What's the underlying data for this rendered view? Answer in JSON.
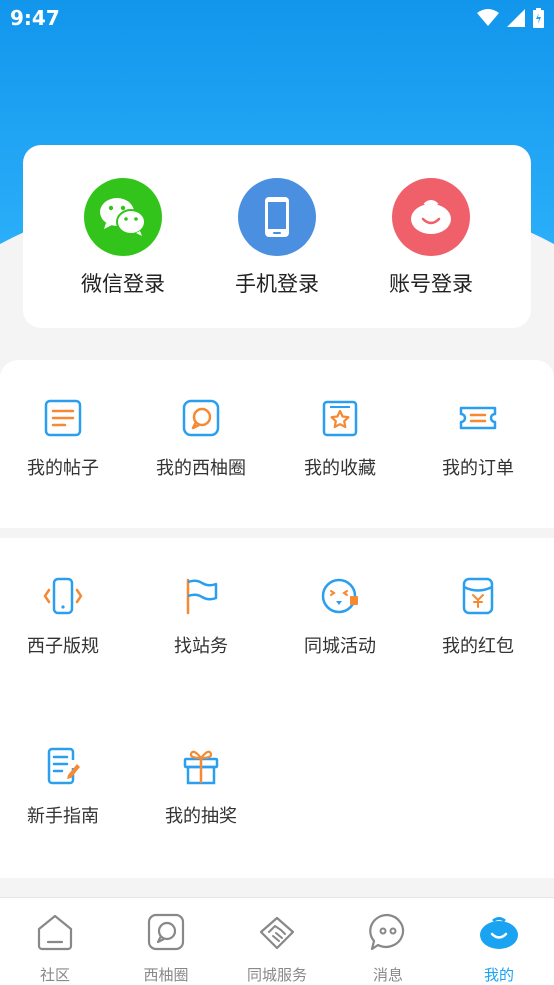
{
  "status_bar": {
    "time": "9:47"
  },
  "login": {
    "options": [
      {
        "label": "微信登录",
        "icon": "wechat-icon",
        "color": "#33c41b"
      },
      {
        "label": "手机登录",
        "icon": "phone-icon",
        "color": "#4a8fe0"
      },
      {
        "label": "账号登录",
        "icon": "account-icon",
        "color": "#f0606a"
      }
    ]
  },
  "menu_section_1": {
    "items": [
      {
        "label": "我的帖子",
        "icon": "posts-icon"
      },
      {
        "label": "我的西柚圈",
        "icon": "circle-chat-icon"
      },
      {
        "label": "我的收藏",
        "icon": "favorites-star-icon"
      },
      {
        "label": "我的订单",
        "icon": "order-ticket-icon"
      }
    ]
  },
  "menu_section_2": {
    "items": [
      {
        "label": "西子版规",
        "icon": "rules-phone-icon"
      },
      {
        "label": "找站务",
        "icon": "flag-icon"
      },
      {
        "label": "同城活动",
        "icon": "activity-face-icon"
      },
      {
        "label": "我的红包",
        "icon": "red-envelope-icon"
      },
      {
        "label": "新手指南",
        "icon": "guide-doc-icon"
      },
      {
        "label": "我的抽奖",
        "icon": "gift-icon"
      }
    ]
  },
  "tabbar": {
    "tabs": [
      {
        "label": "社区",
        "icon": "home-icon"
      },
      {
        "label": "西柚圈",
        "icon": "chat-square-icon"
      },
      {
        "label": "同城服务",
        "icon": "handshake-icon"
      },
      {
        "label": "消息",
        "icon": "message-icon"
      },
      {
        "label": "我的",
        "icon": "profile-icon",
        "active": true
      }
    ]
  },
  "colors": {
    "accent": "#1aa3f0",
    "icon_blue": "#2a9ff0",
    "icon_orange": "#f58a33"
  }
}
